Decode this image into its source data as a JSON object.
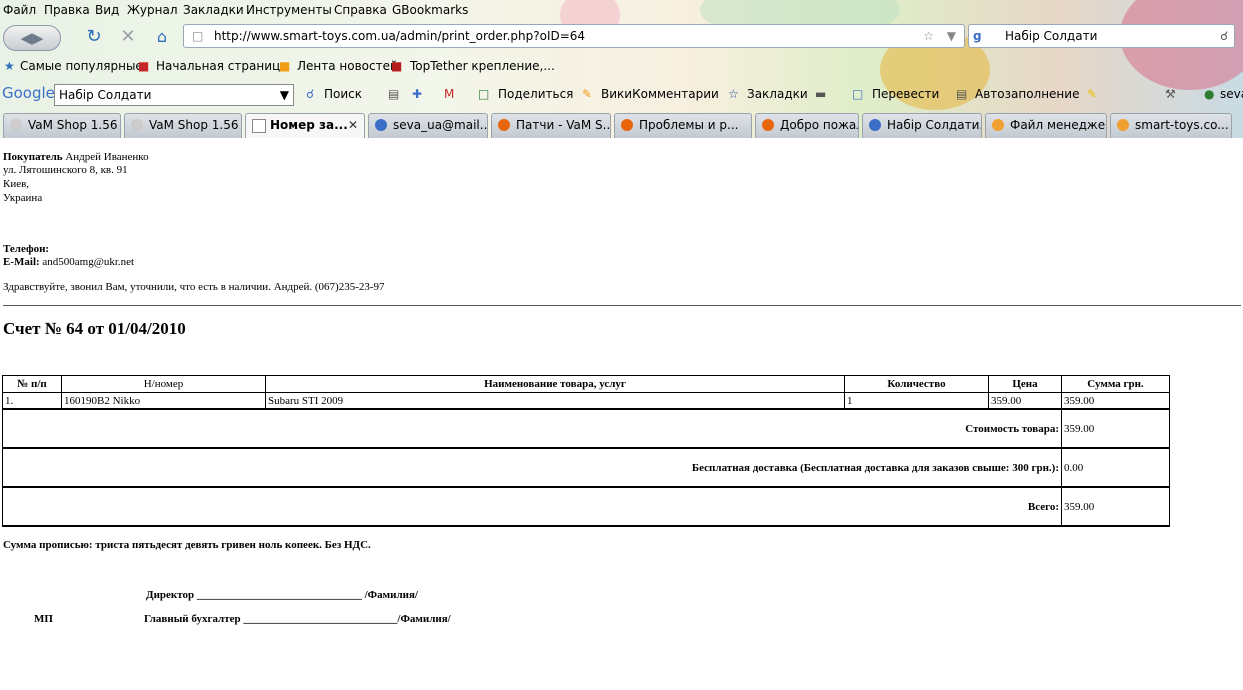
{
  "menu": [
    "Файл",
    "Правка",
    "Вид",
    "Журнал",
    "Закладки",
    "Инструменты",
    "Справка",
    "GBookmarks"
  ],
  "nav": {
    "url": "http://www.smart-toys.com.ua/admin/print_order.php?oID=64",
    "search_text": "Набір Солдати"
  },
  "bookmarks": [
    "Самые популярные",
    "Начальная страница",
    "Лента новостей",
    "TopTether крепление,..."
  ],
  "google_toolbar": {
    "logo": "Google",
    "query": "Набір Солдати",
    "search_label": "Поиск",
    "share_label": "Поделиться",
    "wiki_label": "ВикиКомментарии",
    "bookmarks_label": "Закладки",
    "translate_label": "Перевести",
    "autofill_label": "Автозаполнение",
    "user_label": "seva"
  },
  "tabs": [
    {
      "label": "VaM Shop 1.56"
    },
    {
      "label": "VaM Shop 1.56"
    },
    {
      "label": "Номер за..."
    },
    {
      "label": "seva_ua@mail...."
    },
    {
      "label": "Патчи - VaM S..."
    },
    {
      "label": "Проблемы и р..."
    },
    {
      "label": "Добро пожал..."
    },
    {
      "label": "Набір Солдати..."
    },
    {
      "label": "Файл менеджер"
    },
    {
      "label": "smart-toys.co..."
    }
  ],
  "order": {
    "buyer_label": "Покупатель",
    "buyer_name": "Андрей Иваненко",
    "address1": "ул. Лятошинского 8, кв. 91",
    "city": "Киев,",
    "country": "Украина",
    "phone_label": "Телефон:",
    "email_label": "E-Mail:",
    "email": "and500amg@ukr.net",
    "comment": "Здравствуйте, звонил Вам, уточнили, что есть в наличии. Андрей. (067)235-23-97",
    "title": "Счет № 64 от 01/04/2010",
    "columns": [
      "№ п/п",
      "Н/номер",
      "Наименование товара, услуг",
      "Количество",
      "Цена",
      "Сумма грн."
    ],
    "row": {
      "num": "1.",
      "sku": "160190B2 Nikko",
      "name": "Subaru STI 2009",
      "qty": "1",
      "price": "359.00",
      "sum": "359.00"
    },
    "subtotal_label": "Стоимость товара:",
    "subtotal": "359.00",
    "shipping_label": "Бесплатная доставка (Бесплатная доставка для заказов свыше: 300 грн.):",
    "shipping": "0.00",
    "total_label": "Всего:",
    "total": "359.00",
    "words": "Сумма прописью: триста пятьдесят девять гривен ноль копеек. Без НДС.",
    "director": "Директор ______________________________ /Фамилия/",
    "mp": "МП",
    "accountant": "Главный бухгалтер ____________________________/Фамилия/"
  }
}
